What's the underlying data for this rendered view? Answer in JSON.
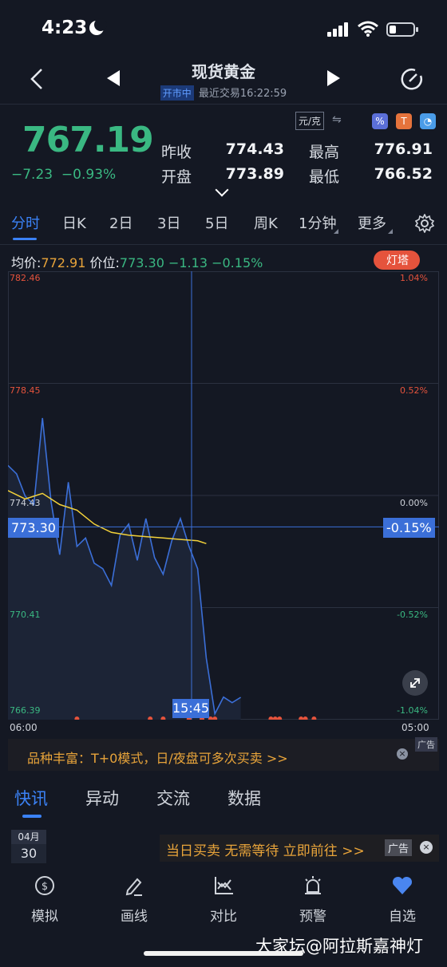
{
  "status": {
    "time": "4:23"
  },
  "header": {
    "title": "现货黄金",
    "market_state": "开市中",
    "last_trade": "最近交易16:22:59"
  },
  "quote": {
    "price": "767.19",
    "change": "−7.23",
    "change_pct": "−0.93%",
    "unit": "元/克",
    "prev_close_label": "昨收",
    "prev_close": "774.43",
    "high_label": "最高",
    "high": "776.91",
    "open_label": "开盘",
    "open": "773.89",
    "low_label": "最低",
    "low": "766.52"
  },
  "tabs": [
    "分时",
    "日K",
    "2日",
    "3日",
    "5日",
    "周K",
    "1分钟",
    "更多"
  ],
  "info": {
    "avg_label": "均价:",
    "avg": "772.91",
    "price_label": "价位:",
    "price": "773.30",
    "diff": "−1.13",
    "diff_pct": "−0.15%",
    "lighthouse": "灯塔"
  },
  "chart_data": {
    "type": "line",
    "y_left_ticks": [
      "782.46",
      "778.45",
      "774.43",
      "770.41",
      "766.39"
    ],
    "y_right_ticks": [
      "1.04%",
      "0.52%",
      "0.00%",
      "-0.52%",
      "-1.04%"
    ],
    "x_ticks": [
      "06:00",
      "05:00"
    ],
    "ylim": [
      766.39,
      782.46
    ],
    "crosshair_price": "773.30",
    "crosshair_pct": "-0.15%",
    "crosshair_time": "15:45",
    "series": [
      {
        "name": "价格",
        "color": "#3b6fd8",
        "x": [
          0,
          0.02,
          0.04,
          0.06,
          0.08,
          0.1,
          0.12,
          0.14,
          0.16,
          0.18,
          0.2,
          0.22,
          0.24,
          0.26,
          0.28,
          0.3,
          0.32,
          0.34,
          0.36,
          0.38,
          0.4,
          0.42,
          0.44,
          0.46,
          0.48,
          0.5,
          0.52,
          0.54
        ],
        "values": [
          775.5,
          775.2,
          774.4,
          774.1,
          777.2,
          774.2,
          772.3,
          774.9,
          772.6,
          772.9,
          772.0,
          771.8,
          771.2,
          773.0,
          773.4,
          772.1,
          773.6,
          772.2,
          771.6,
          772.8,
          773.6,
          772.6,
          771.8,
          768.6,
          766.6,
          767.2,
          767.0,
          767.19
        ]
      },
      {
        "name": "均价",
        "color": "#f3d23a",
        "x": [
          0,
          0.04,
          0.08,
          0.12,
          0.16,
          0.2,
          0.24,
          0.28,
          0.32,
          0.36,
          0.4,
          0.44,
          0.46
        ],
        "values": [
          774.6,
          774.3,
          774.5,
          774.1,
          773.9,
          773.4,
          773.1,
          773.0,
          772.95,
          772.9,
          772.85,
          772.8,
          772.7
        ]
      }
    ],
    "markers": [
      0.16,
      0.33,
      0.36,
      0.42,
      0.45,
      0.47,
      0.48,
      0.61,
      0.62,
      0.63,
      0.68,
      0.69,
      0.71
    ]
  },
  "ad1": {
    "text": "品种丰富：T+0模式，日/夜盘可多次买卖 >>",
    "badge": "广告",
    "close": "×"
  },
  "news_tabs": [
    "快讯",
    "异动",
    "交流",
    "数据"
  ],
  "date": {
    "month": "04月",
    "day": "30"
  },
  "ad2": {
    "text": "当日买卖 无需等待 立即前往 >>",
    "badge": "广告",
    "close": "×"
  },
  "bottom_nav": [
    "模拟",
    "画线",
    "对比",
    "预警",
    "自选"
  ],
  "watermark": "大家坛@阿拉斯嘉神灯",
  "colors": {
    "up": "#e5533c",
    "down": "#3ab882",
    "accent": "#3b82f6",
    "background": "#141823"
  }
}
